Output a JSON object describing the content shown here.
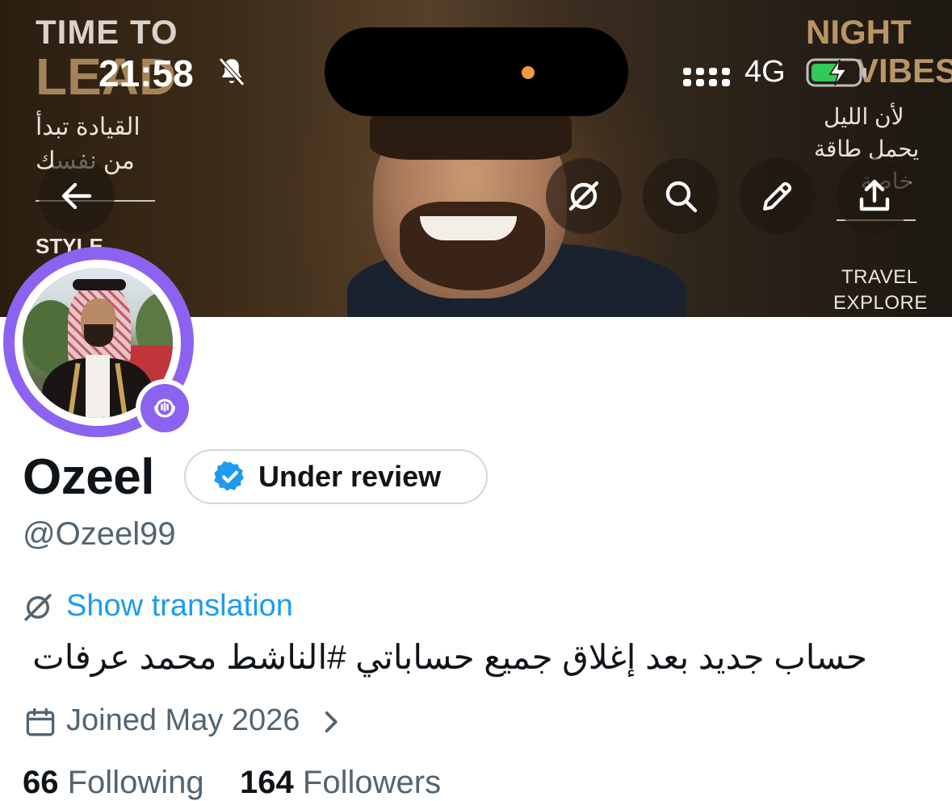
{
  "banner": {
    "left_title": "TIME TO",
    "left_title_big": "LEAD",
    "left_arabic_1": "القيادة تبدأ",
    "left_arabic_2": "من نفسك",
    "left_footer": "STYLE",
    "right_title": "NIGHT",
    "right_title_big": "VIBES",
    "right_arabic_1": "لأن الليل",
    "right_arabic_2": "يحمل طاقة",
    "right_arabic_3": "خاصة",
    "right_footer_1": "TRAVEL",
    "right_footer_2": "EXPLORE"
  },
  "status_bar": {
    "time": "21:58",
    "network": "4G",
    "silent_icon": "bell-slash-icon",
    "battery_state": "charging",
    "island_indicator_color": "#f29a3e"
  },
  "header_actions": [
    {
      "name": "back-arrow-icon"
    },
    {
      "name": "translate-icon"
    },
    {
      "name": "search-icon"
    },
    {
      "name": "edit-icon"
    },
    {
      "name": "share-icon"
    }
  ],
  "profile": {
    "display_name": "Ozeel",
    "verification_label": "Under review",
    "handle": "@Ozeel99",
    "translate_label": "Show translation",
    "bio": "حساب جديد بعد إغلاق جميع حساباتي #الناشط محمد عرفات",
    "joined": "Joined May 2026",
    "following_count": "66",
    "following_label": "Following",
    "followers_count": "164",
    "followers_label": "Followers"
  },
  "colors": {
    "accent_purple": "#8b63f0",
    "link_blue": "#1d9bf0",
    "verified_blue": "#1d9bf0",
    "text_primary": "#0f1419",
    "text_secondary": "#536471"
  }
}
